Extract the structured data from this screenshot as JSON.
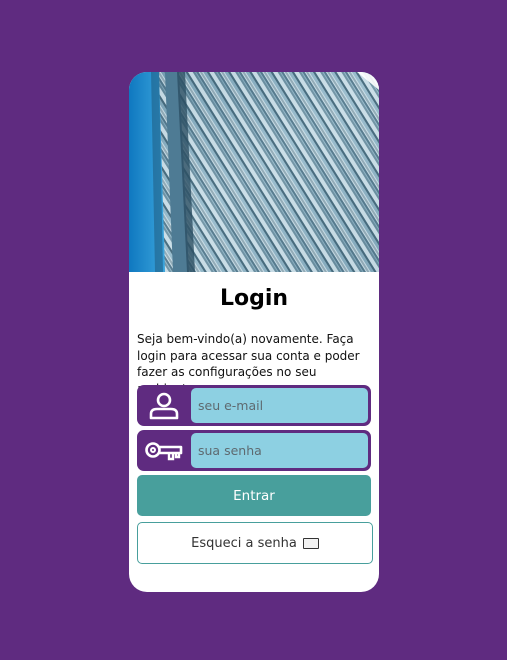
{
  "login": {
    "title": "Login",
    "description": "Seja bem-vindo(a) novamente. Faça login para acessar sua conta e poder fazer as configurações no seu ambiente.",
    "email_placeholder": "seu e-mail",
    "password_placeholder": "sua senha",
    "submit_label": "Entrar",
    "forgot_label": "Esqueci a senha",
    "hero_image": "building-facade-image"
  },
  "icons": {
    "email_field": "user-icon",
    "password_field": "key-icon",
    "forgot_button": "envelope-icon"
  },
  "colors": {
    "background": "#5f2b80",
    "card": "#ffffff",
    "field_frame": "#5f2b80",
    "input_fill": "#8dd0e2",
    "primary_button": "#489f9c"
  }
}
